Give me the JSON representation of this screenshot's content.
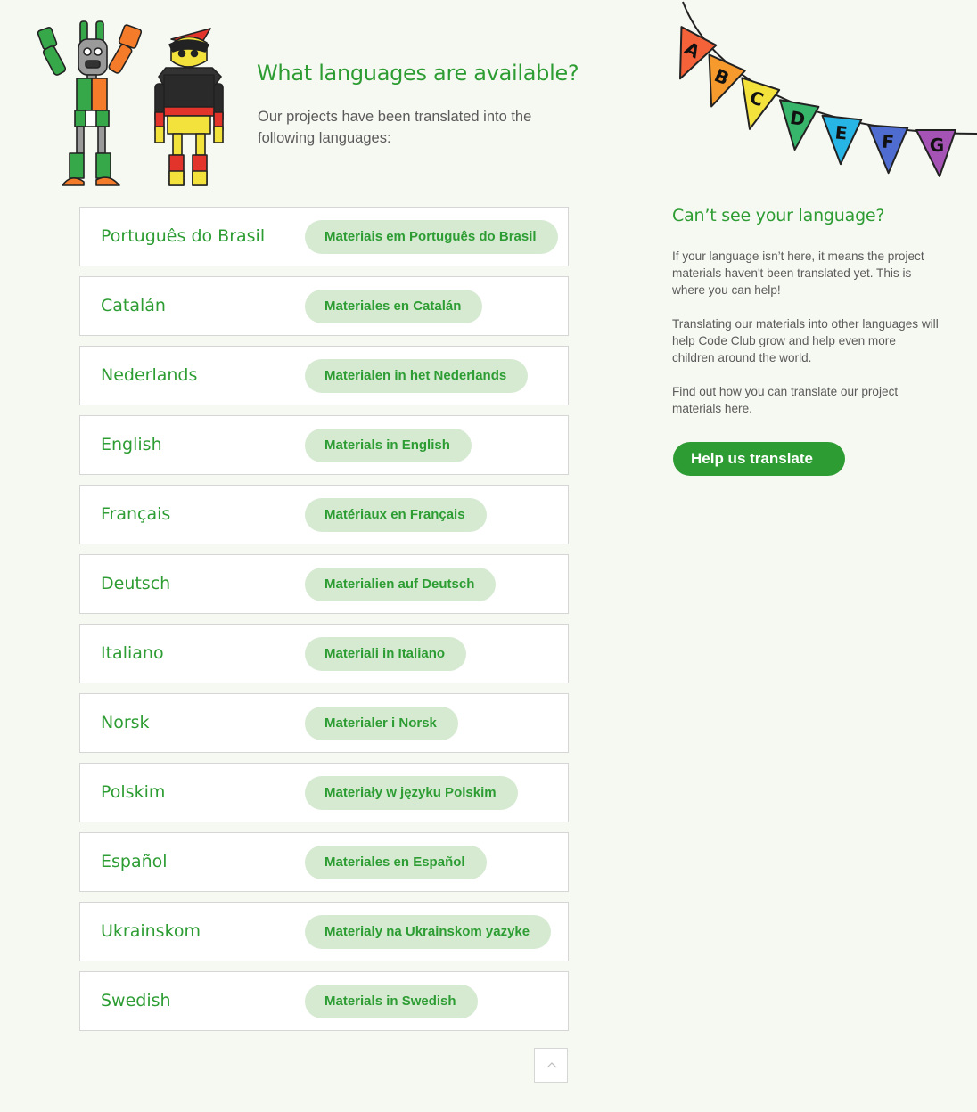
{
  "intro": {
    "title": "What languages are available?",
    "text": "Our projects have been translated into the following languages:"
  },
  "languages": [
    {
      "name": "Português do Brasil",
      "button": "Materiais em Português do Brasil"
    },
    {
      "name": "Catalán",
      "button": "Materiales en Catalán"
    },
    {
      "name": "Nederlands",
      "button": "Materialen in het Nederlands"
    },
    {
      "name": "English",
      "button": "Materials in English"
    },
    {
      "name": "Français",
      "button": "Matériaux en Français"
    },
    {
      "name": "Deutsch",
      "button": "Materialien auf Deutsch"
    },
    {
      "name": "Italiano",
      "button": "Materiali in Italiano"
    },
    {
      "name": "Norsk",
      "button": "Materialer i Norsk"
    },
    {
      "name": "Polskim",
      "button": "Materiały w języku Polskim"
    },
    {
      "name": "Español",
      "button": "Materiales en Español"
    },
    {
      "name": "Ukrainskom",
      "button": "Materialy na Ukrainskom yazyke"
    },
    {
      "name": "Swedish",
      "button": "Materials in Swedish"
    }
  ],
  "sidebar": {
    "title": "Can’t see your language?",
    "p1": "If your language isn’t here, it means the project materials haven't been translated yet. This is where you can help!",
    "p2": "Translating our materials into other languages will help Code Club grow and help even more children around the world.",
    "p3": "Find out how you can translate our project materials here.",
    "button": "Help us translate"
  },
  "bunting": {
    "letters": [
      "A",
      "B",
      "C",
      "D",
      "E",
      "F",
      "G"
    ],
    "colors": [
      "#f4623a",
      "#f79a2e",
      "#f4e23c",
      "#37b56a",
      "#27b5e6",
      "#4f6cd0",
      "#a553b5"
    ]
  },
  "colors": {
    "brand_green": "#2d9d33",
    "button_bg": "#d6ead2",
    "page_bg": "#f6f8f2"
  }
}
